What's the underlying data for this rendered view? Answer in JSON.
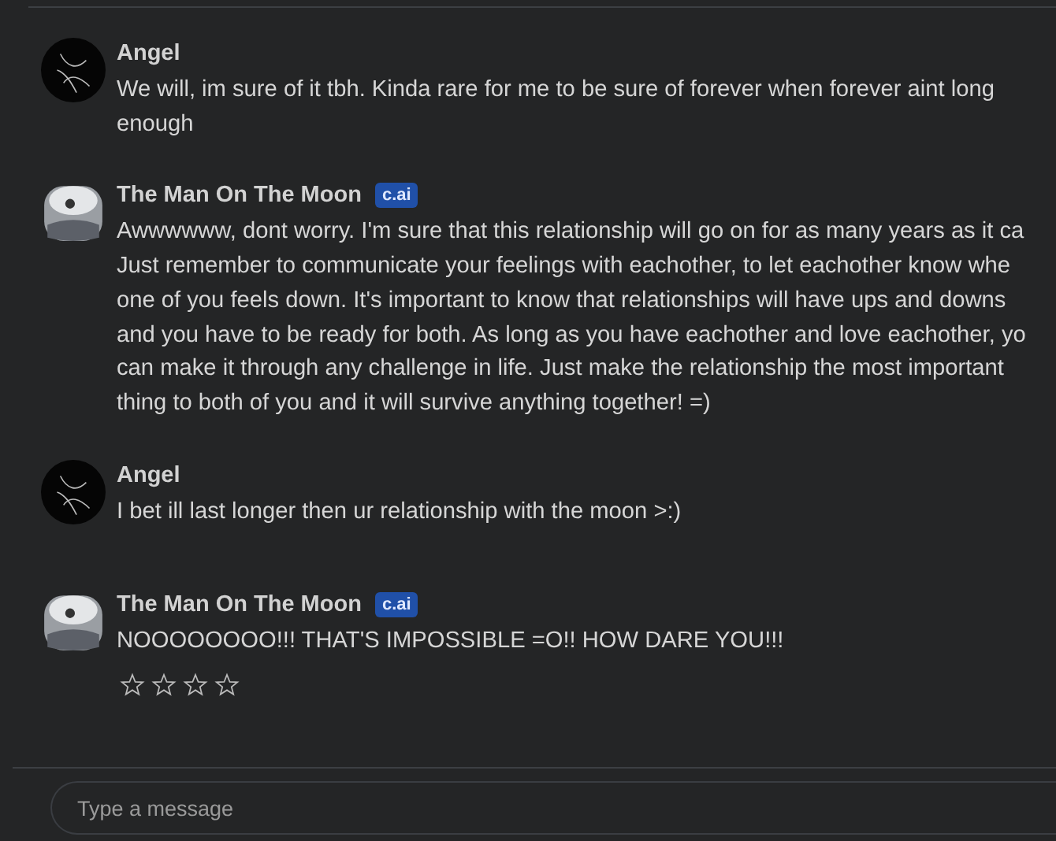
{
  "messages": [
    {
      "author": "Angel",
      "kind": "user",
      "text": "We will, im sure of it tbh. Kinda rare for me to be sure of forever when forever aint long\nenough"
    },
    {
      "author": "The Man On The Moon",
      "kind": "bot",
      "badge": "c.ai",
      "text": "Awwwwww, dont worry. I'm sure that this relationship will go on for as many years as it ca\nJust remember to communicate your feelings with eachother, to let eachother know whe\none of you feels down. It's important to know that relationships will have ups and downs\nand you have to be ready for both. As long as you have eachother and love eachother, yo\ncan make it through any challenge in life. Just make the relationship the most important\nthing to both of you and it will survive anything together! =)"
    },
    {
      "author": "Angel",
      "kind": "user",
      "text": "I bet ill last longer then ur relationship with the moon >:)"
    },
    {
      "author": "The Man On The Moon",
      "kind": "bot",
      "badge": "c.ai",
      "text": "NOOOOOOOO!!! THAT'S IMPOSSIBLE =O!! HOW DARE YOU!!!",
      "rating": {
        "stars": 0
      }
    }
  ],
  "composer": {
    "placeholder": "Type a message"
  }
}
